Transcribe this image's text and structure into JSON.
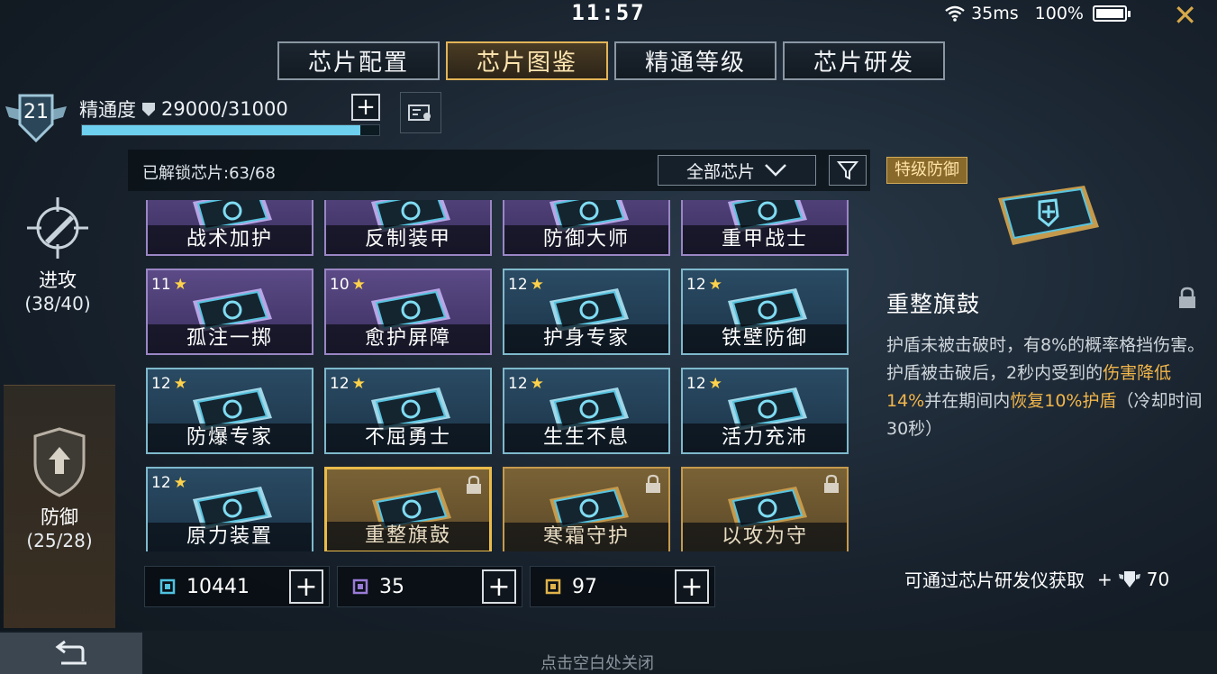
{
  "status": {
    "time": "11:57",
    "ping": "35ms",
    "battery": "100%"
  },
  "tabs": [
    {
      "label": "芯片配置",
      "active": false
    },
    {
      "label": "芯片图鉴",
      "active": true
    },
    {
      "label": "精通等级",
      "active": false
    },
    {
      "label": "芯片研发",
      "active": false
    }
  ],
  "mastery": {
    "level": "21",
    "label": "精通度",
    "value": "29000/31000",
    "progress": 0.935
  },
  "categories": [
    {
      "label": "进攻",
      "count": "(38/40)"
    },
    {
      "label": "防御",
      "count": "(25/28)"
    }
  ],
  "grid_header": {
    "unlocked": "已解锁芯片:63/68",
    "filter": "全部芯片"
  },
  "chips": [
    {
      "name": "战术加护",
      "level": "",
      "style": "purple"
    },
    {
      "name": "反制装甲",
      "level": "",
      "style": "purple"
    },
    {
      "name": "防御大师",
      "level": "",
      "style": "purple"
    },
    {
      "name": "重甲战士",
      "level": "",
      "style": "purple"
    },
    {
      "name": "孤注一掷",
      "level": "11",
      "style": "purple"
    },
    {
      "name": "愈护屏障",
      "level": "10",
      "style": "purple"
    },
    {
      "name": "护身专家",
      "level": "12",
      "style": "blue"
    },
    {
      "name": "铁壁防御",
      "level": "12",
      "style": "blue"
    },
    {
      "name": "防爆专家",
      "level": "12",
      "style": "blue"
    },
    {
      "name": "不屈勇士",
      "level": "12",
      "style": "blue"
    },
    {
      "name": "生生不息",
      "level": "12",
      "style": "blue"
    },
    {
      "name": "活力充沛",
      "level": "12",
      "style": "blue"
    },
    {
      "name": "原力装置",
      "level": "12",
      "style": "blue"
    },
    {
      "name": "重整旗鼓",
      "level": "",
      "style": "gold",
      "locked": true,
      "selected": true
    },
    {
      "name": "寒霜守护",
      "level": "",
      "style": "gold",
      "locked": true
    },
    {
      "name": "以攻为守",
      "level": "",
      "style": "gold",
      "locked": true
    }
  ],
  "resources": [
    {
      "value": "10441",
      "color": "#4fc3e0"
    },
    {
      "value": "35",
      "color": "#9a7bd8"
    },
    {
      "value": "97",
      "color": "#e0b34a"
    }
  ],
  "detail": {
    "grade": "特级防御",
    "name": "重整旗鼓",
    "desc_1": "护盾未被击破时，有8%的概率格挡伤害。护盾被击破后，2秒内受到的",
    "desc_hl1": "伤害降低14%",
    "desc_2": "并在期间内",
    "desc_hl2": "恢复10%护盾",
    "desc_3": "（冷却时间30秒）",
    "obtain": "可通过芯片研发仪获取",
    "cost_prefix": "+",
    "cost": "70"
  },
  "footer": {
    "tap_close": "点击空白处关闭"
  },
  "icons": [
    "wifi-icon",
    "battery-icon",
    "close-icon",
    "shield-icon",
    "plus-icon",
    "card-icon",
    "crosshair-icon",
    "filter-icon",
    "chevron-down-icon",
    "lock-icon",
    "chip-icon",
    "back-arrow-icon"
  ]
}
